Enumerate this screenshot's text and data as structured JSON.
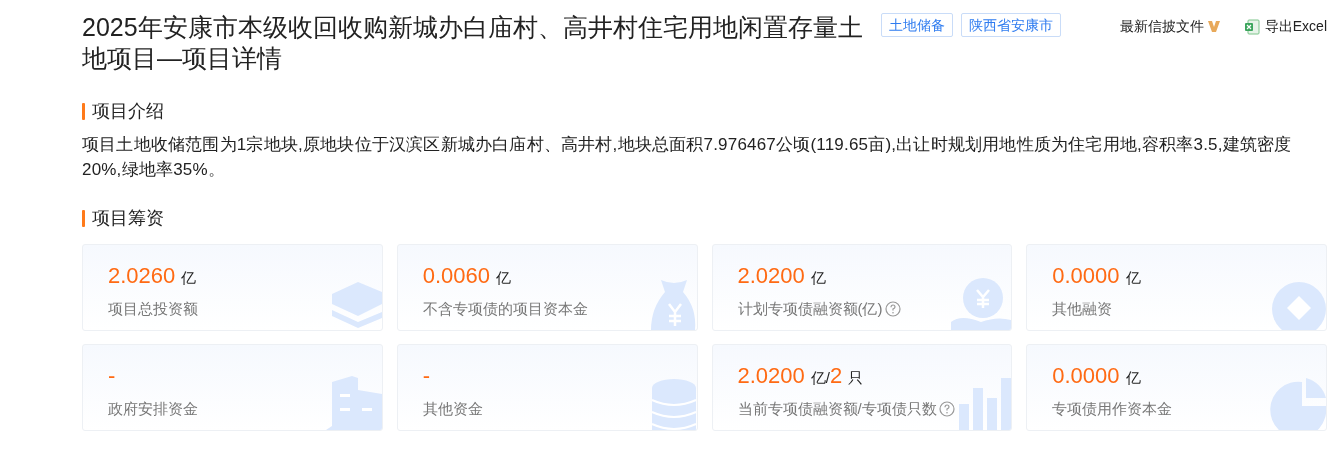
{
  "title": "2025年安康市本级收回收购新城办白庙村、高井村住宅用地闲置存量土地项目—项目详情",
  "tags": [
    "土地储备",
    "陕西省安康市"
  ],
  "actions": [
    {
      "kind": "dropdown",
      "label": "最新信披文件"
    },
    {
      "kind": "excel",
      "label": "导出Excel"
    }
  ],
  "intro": {
    "heading": "项目介绍",
    "text": "项目土地收储范围为1宗地块,原地块位于汉滨区新城办白庙村、高井村,地块总面积7.976467公顷(119.65亩),出让时规划用地性质为住宅用地,容积率3.5,建筑密度20%,绿地率35%。"
  },
  "funding": {
    "heading": "项目筹资",
    "cards": [
      {
        "value": [
          {
            "kind": "number",
            "text": "2.0260"
          },
          {
            "kind": "unit",
            "text": "亿"
          }
        ],
        "label": "项目总投资额",
        "help": false
      },
      {
        "value": [
          {
            "kind": "number",
            "text": "0.0060"
          },
          {
            "kind": "unit",
            "text": "亿"
          }
        ],
        "label": "不含专项债的项目资本金",
        "help": false
      },
      {
        "value": [
          {
            "kind": "number",
            "text": "2.0200"
          },
          {
            "kind": "unit",
            "text": "亿"
          }
        ],
        "label": "计划专项债融资额(亿)",
        "help": true
      },
      {
        "value": [
          {
            "kind": "number",
            "text": "0.0000"
          },
          {
            "kind": "unit",
            "text": "亿"
          }
        ],
        "label": "其他融资",
        "help": false
      },
      {
        "value": [
          {
            "kind": "number",
            "text": "-"
          }
        ],
        "label": "政府安排资金",
        "help": false
      },
      {
        "value": [
          {
            "kind": "number",
            "text": "-"
          }
        ],
        "label": "其他资金",
        "help": false
      },
      {
        "value": [
          {
            "kind": "number",
            "text": "2.0200"
          },
          {
            "kind": "unit",
            "text": "亿/"
          },
          {
            "kind": "number",
            "text": "2"
          },
          {
            "kind": "unit",
            "text": "只"
          }
        ],
        "label": "当前专项债融资额/专项债只数",
        "help": true
      },
      {
        "value": [
          {
            "kind": "number",
            "text": "0.0000"
          },
          {
            "kind": "unit",
            "text": "亿"
          }
        ],
        "label": "专项债用作资本金",
        "help": false
      }
    ]
  }
}
